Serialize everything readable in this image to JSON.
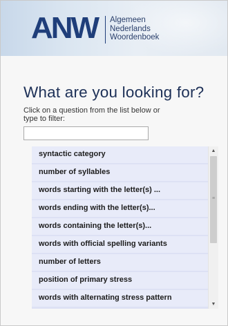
{
  "header": {
    "logo_mark": "ANW",
    "logo_words": [
      "Algemeen",
      "Nederlands",
      "Woordenboek"
    ]
  },
  "main": {
    "title": "What are you looking for?",
    "instructions": "Click on a question from the list below or type to filter:",
    "filter": {
      "value": "",
      "placeholder": ""
    }
  },
  "questions": [
    "syntactic category",
    "number of syllables",
    "words starting with the letter(s) ...",
    "words ending with the letter(s)...",
    "words containing the letter(s)...",
    "words with official spelling variants",
    "number of letters",
    "position of primary stress",
    "words with alternating stress pattern"
  ],
  "scrollbar": {
    "up_icon": "triangle-up-icon",
    "down_icon": "triangle-down-icon",
    "position": 0.0
  },
  "colors": {
    "brand": "#1f3e7a",
    "title": "#1d3057",
    "list_bg": "#dde1f4",
    "item_bg": "#e8ebf9"
  }
}
